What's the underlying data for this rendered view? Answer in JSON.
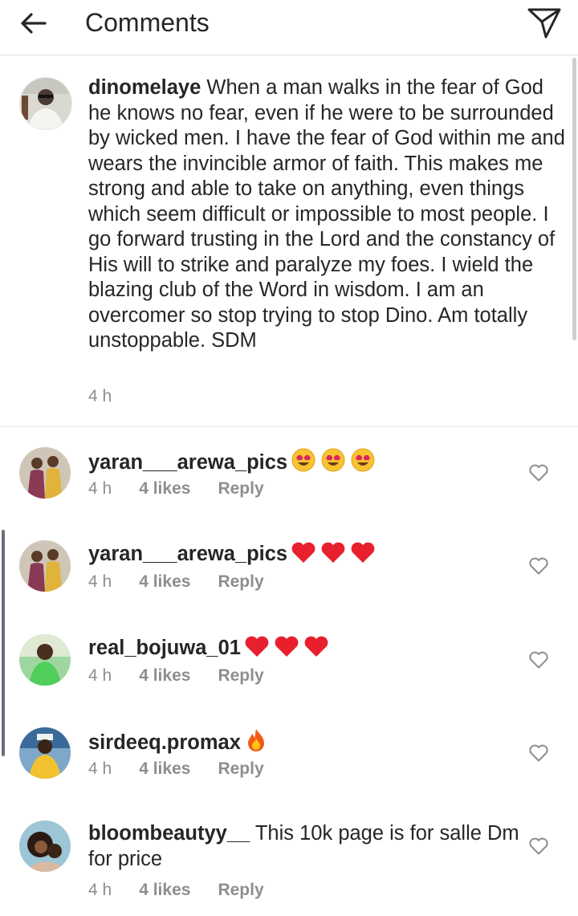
{
  "header": {
    "title": "Comments"
  },
  "caption": {
    "username": "dinomelaye",
    "text": "When a man walks in the fear of God he knows no fear, even if he were to be surrounded by wicked men. I have the fear of God within me and wears the invincible armor of faith. This makes me strong and able to take on anything, even things which seem difficult or impossible to most people. I go forward trusting in the Lord and the constancy of His will to strike and paralyze my foes. I wield the blazing club of the Word in wisdom. I am an overcomer so stop trying to stop Dino. Am totally unstoppable. SDM",
    "time": "4 h"
  },
  "comments": [
    {
      "username": "yaran___arewa_pics",
      "text": "",
      "emoji": "heart-eyes-emoji",
      "time": "4 h",
      "likes": "4 likes",
      "reply": "Reply"
    },
    {
      "username": "yaran___arewa_pics",
      "text": "",
      "emoji": "red-heart-emoji",
      "time": "4 h",
      "likes": "4 likes",
      "reply": "Reply"
    },
    {
      "username": "real_bojuwa_01",
      "text": "",
      "emoji": "red-heart-emoji",
      "time": "4 h",
      "likes": "4 likes",
      "reply": "Reply"
    },
    {
      "username": "sirdeeq.promax",
      "text": "",
      "emoji": "fire-emoji",
      "time": "4 h",
      "likes": "4 likes",
      "reply": "Reply"
    },
    {
      "username": "bloombeautyy__",
      "text": "This 10k page is for salle Dm for price",
      "emoji": "",
      "time": "4 h",
      "likes": "4 likes",
      "reply": "Reply"
    }
  ],
  "icons": {
    "back": "arrow-left-icon",
    "send": "paper-plane-icon",
    "like": "heart-outline-icon"
  },
  "colors": {
    "text": "#262626",
    "muted": "#8e8e8e",
    "divider": "#dbdbdb"
  }
}
